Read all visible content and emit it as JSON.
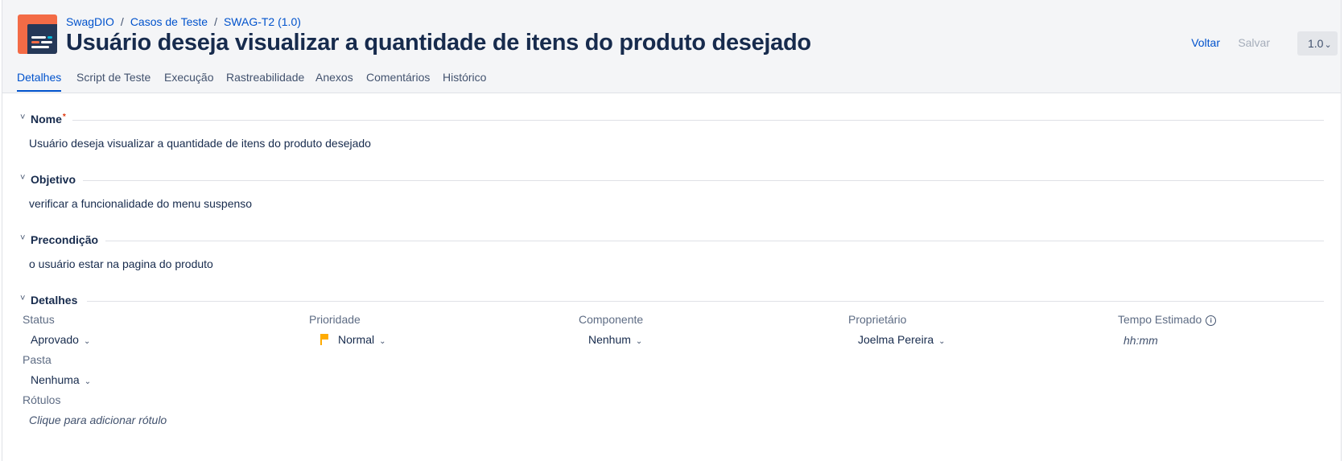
{
  "breadcrumb": {
    "project": "SwagDIO",
    "section": "Casos de Teste",
    "item": "SWAG-T2 (1.0)",
    "separator": "/"
  },
  "title": "Usuário deseja visualizar a quantidade de itens do produto desejado",
  "actions": {
    "back_label": "Voltar",
    "save_label": "Salvar",
    "version": "1.0"
  },
  "tabs": [
    {
      "label": "Detalhes",
      "active": true
    },
    {
      "label": "Script de Teste",
      "active": false
    },
    {
      "label": "Execução",
      "active": false
    },
    {
      "label": "Rastreabilidade",
      "active": false
    },
    {
      "label": "Anexos",
      "active": false
    },
    {
      "label": "Comentários",
      "active": false
    },
    {
      "label": "Histórico",
      "active": false
    }
  ],
  "sections": {
    "nome": {
      "label": "Nome",
      "required_mark": "*",
      "value": "Usuário deseja visualizar a quantidade de itens do produto desejado"
    },
    "objetivo": {
      "label": "Objetivo",
      "value": "verificar a funcionalidade do menu suspenso"
    },
    "precondicao": {
      "label": "Precondição",
      "value": "o usuário estar na pagina do produto"
    },
    "detalhes": {
      "label": "Detalhes"
    }
  },
  "fields": {
    "status": {
      "label": "Status",
      "value": "Aprovado"
    },
    "prioridade": {
      "label": "Prioridade",
      "value": "Normal",
      "flag_color": "#ffab00"
    },
    "componente": {
      "label": "Componente",
      "value": "Nenhum"
    },
    "proprietario": {
      "label": "Proprietário",
      "value": "Joelma Pereira"
    },
    "tempo": {
      "label": "Tempo Estimado",
      "placeholder": "hh:mm"
    },
    "pasta": {
      "label": "Pasta",
      "value": "Nenhuma"
    },
    "rotulos": {
      "label": "Rótulos",
      "placeholder": "Clique para adicionar rótulo"
    }
  },
  "icons": {
    "chevron": "˅",
    "caret": "⌄",
    "info": "i"
  },
  "colors": {
    "link": "#0052cc",
    "text": "#172b4d",
    "header_bg": "#f4f5f7",
    "logo": "#f36b46",
    "required": "#de350b"
  }
}
